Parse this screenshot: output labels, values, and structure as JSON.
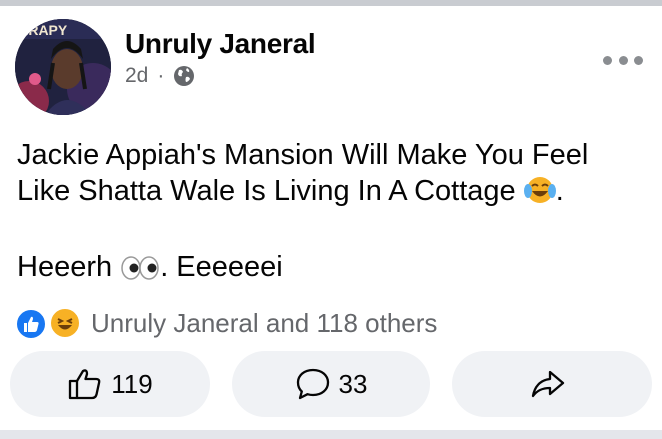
{
  "post": {
    "author": "Unruly Janeral",
    "avatar_text": "ERAPY",
    "time": "2d",
    "dot": "·",
    "privacy_icon": "globe-icon",
    "text_line1": "Jackie Appiah's Mansion Will Make You Feel",
    "text_line2": "Like Shatta Wale Is Living In A Cottage",
    "text_line2_emoji": "tears-of-joy-emoji",
    "text_line2_end": ".",
    "text_line3_start": "Heeerh",
    "text_line3_emoji": "eyes-emoji",
    "text_line3_end": ". Eeeeeei"
  },
  "reactions": {
    "icons": [
      "like-icon",
      "haha-icon"
    ],
    "summary": "Unruly Janeral and 118 others"
  },
  "actions": {
    "like_count": "119",
    "comment_count": "33",
    "share_icon": "share-icon"
  },
  "colors": {
    "accent": "#1877f2",
    "button_bg": "#f0f2f5",
    "secondary_text": "#65676b",
    "haha_yellow": "#f7b125"
  }
}
